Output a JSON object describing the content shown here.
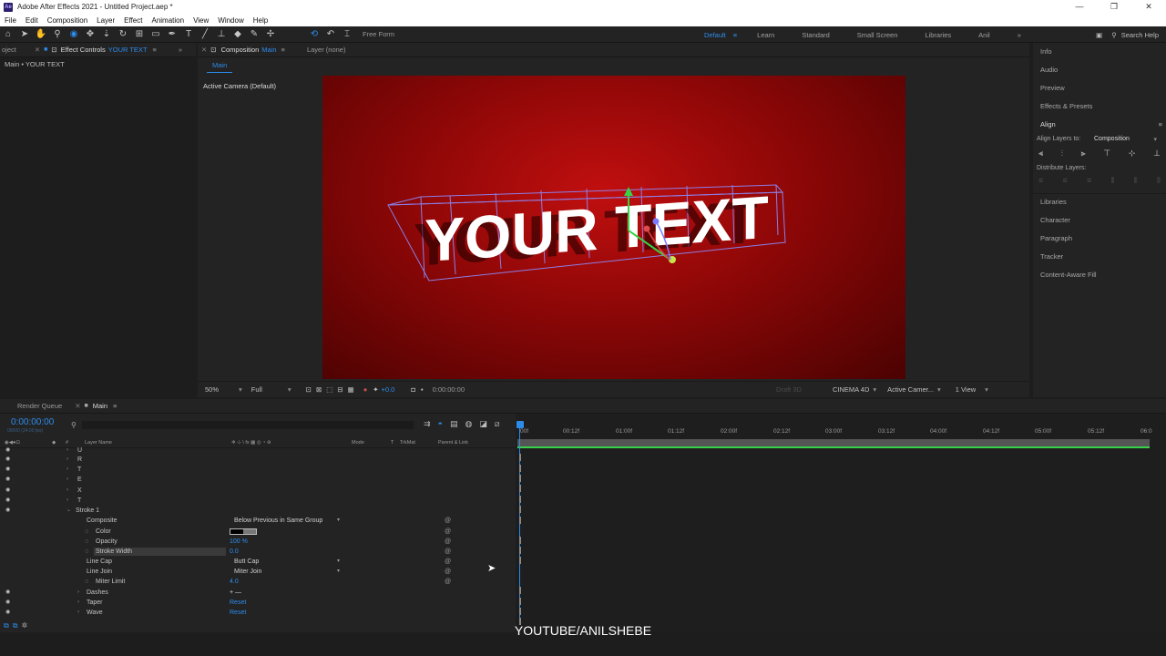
{
  "window": {
    "title": "Adobe After Effects 2021 - Untitled Project.aep *",
    "logo_text": "Ae",
    "controls": [
      "—",
      "❐",
      "✕"
    ]
  },
  "menu": [
    "File",
    "Edit",
    "Composition",
    "Layer",
    "Effect",
    "Animation",
    "View",
    "Window",
    "Help"
  ],
  "toolbar": {
    "free_form": "Free Form",
    "workspaces": [
      "Default",
      "Learn",
      "Standard",
      "Small Screen",
      "Libraries",
      "Anil"
    ],
    "active_workspace": "Default",
    "search_label": "Search Help",
    "more": "»"
  },
  "left_panel": {
    "project_tab": "oject",
    "effect_controls_tab": "Effect Controls",
    "effect_controls_layer": "YOUR TEXT",
    "subhead": "Main • YOUR TEXT"
  },
  "composition_panel": {
    "tab_label": "Composition",
    "tab_name": "Main",
    "layer_tab": "Layer (none)",
    "subtab": "Main",
    "active_camera": "Active Camera (Default)",
    "viewer_text": "YOUR TEXT",
    "footer": {
      "zoom": "50%",
      "resolution": "Full",
      "exposure": "+0.0",
      "time": "0:00:00:00",
      "draft3d": "Draft 3D",
      "renderer": "CINEMA 4D",
      "camera": "Active Camer...",
      "views": "1 View"
    }
  },
  "right_panel": {
    "items": [
      "Info",
      "Audio",
      "Preview",
      "Effects & Presets",
      "Align"
    ],
    "align_to_label": "Align Layers to:",
    "align_to_value": "Composition",
    "distribute_label": "Distribute Layers:",
    "items_lower": [
      "Libraries",
      "Character",
      "Paragraph",
      "Tracker",
      "Content-Aware Fill"
    ]
  },
  "timeline": {
    "render_queue_tab": "Render Queue",
    "main_tab": "Main",
    "timecode": "0:00:00:00",
    "timecode_sub": "00000 (24.00 fps)",
    "col_layer_name": "Layer Name",
    "col_mode": "Mode",
    "col_t": "T",
    "col_trkmat": "TrkMat",
    "col_parent": "Parent & Link",
    "ruler": [
      "00f",
      "00:12f",
      "01:00f",
      "01:12f",
      "02:00f",
      "02:12f",
      "03:00f",
      "03:12f",
      "04:00f",
      "04:12f",
      "05:00f",
      "05:12f",
      "06:0"
    ],
    "rows": [
      {
        "label": "U"
      },
      {
        "label": "R"
      },
      {
        "label": "T"
      },
      {
        "label": "E"
      },
      {
        "label": "X"
      },
      {
        "label": "T"
      },
      {
        "label": "Stroke 1"
      },
      {
        "label": "Composite",
        "value": "Below Previous in Same Group"
      },
      {
        "label": "Color"
      },
      {
        "label": "Opacity",
        "value": "100 %"
      },
      {
        "label": "Stroke Width",
        "value": "0.0"
      },
      {
        "label": "Line Cap",
        "value": "Butt Cap"
      },
      {
        "label": "Line Join",
        "value": "Miter Join"
      },
      {
        "label": "Miter Limit",
        "value": "4.0"
      },
      {
        "label": "Dashes",
        "value": "+ —"
      },
      {
        "label": "Taper",
        "value": "Reset"
      },
      {
        "label": "Wave",
        "value": "Reset"
      }
    ]
  },
  "caption": "YOUTUBE/ANILSHEBE",
  "colors": {
    "accent": "#2d8ceb",
    "work_area_green": "#37d24a",
    "viewer_red": "#c10f0f"
  }
}
